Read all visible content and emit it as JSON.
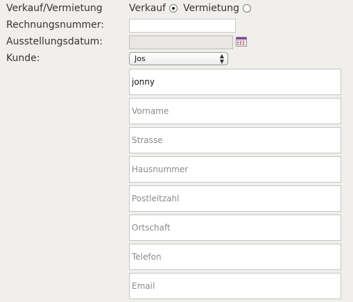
{
  "form": {
    "type_label": "Verkauf/Vermietung",
    "type_options": [
      {
        "label": "Verkauf",
        "checked": true
      },
      {
        "label": "Vermietung",
        "checked": false
      }
    ],
    "invoice_number_label": "Rechnungsnummer:",
    "invoice_number_value": "",
    "issue_date_label": "Ausstellungsdatum:",
    "issue_date_value": "",
    "customer_label": "Kunde:",
    "customer_selected": "Jos"
  },
  "customer_fields": {
    "name": {
      "value": "jonny",
      "placeholder": ""
    },
    "first_name": {
      "value": "",
      "placeholder": "Vorname"
    },
    "street": {
      "value": "",
      "placeholder": "Strasse"
    },
    "house_number": {
      "value": "",
      "placeholder": "Hausnummer"
    },
    "postal_code": {
      "value": "",
      "placeholder": "Postleitzahl"
    },
    "city": {
      "value": "",
      "placeholder": "Ortschaft"
    },
    "phone": {
      "value": "",
      "placeholder": "Telefon"
    },
    "email": {
      "value": "",
      "placeholder": "Email"
    }
  },
  "icons": {
    "calendar": "calendar-icon",
    "select_arrows": "select-arrows-icon"
  },
  "colors": {
    "background": "#f1efeb",
    "input_border": "#c4c4c4",
    "text": "#333333",
    "placeholder": "#8a8a8a"
  }
}
